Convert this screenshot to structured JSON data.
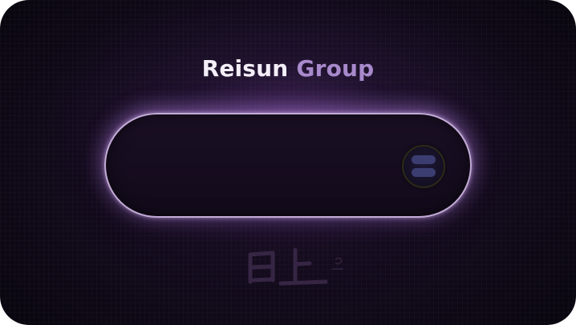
{
  "title": {
    "word1": "Reisun",
    "word2": "Group"
  },
  "toggle": {
    "state": "off",
    "knob_icon": "moon-face-icon"
  },
  "watermark": {
    "text": "日上",
    "icon": "calligraphy-logo-icon"
  },
  "colors": {
    "background": "#110a1a",
    "accent": "#a889cc",
    "title": "#f3eef8",
    "glow": "#e2c8f8"
  }
}
